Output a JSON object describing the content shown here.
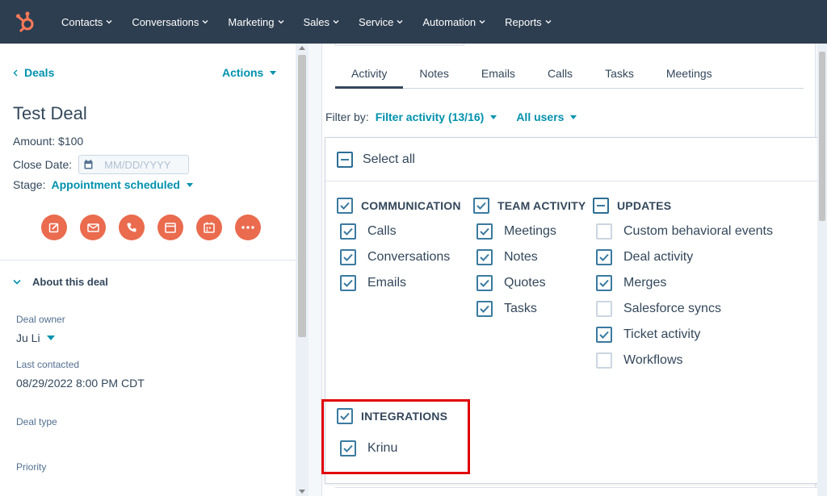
{
  "nav": {
    "logo": "hubspot-logo",
    "items": [
      {
        "label": "Contacts"
      },
      {
        "label": "Conversations"
      },
      {
        "label": "Marketing"
      },
      {
        "label": "Sales"
      },
      {
        "label": "Service"
      },
      {
        "label": "Automation"
      },
      {
        "label": "Reports"
      }
    ]
  },
  "left": {
    "back_label": "Deals",
    "actions_label": "Actions",
    "title": "Test Deal",
    "amount": "Amount: $100",
    "close_date_label": "Close Date:",
    "close_date_placeholder": "MM/DD/YYYY",
    "stage_label": "Stage:",
    "stage_value": "Appointment scheduled",
    "action_icons": [
      "note-icon",
      "email-icon",
      "call-icon",
      "task-icon",
      "meeting-icon",
      "more-icon"
    ],
    "about_label": "About this deal",
    "fields": [
      {
        "label": "Deal owner",
        "value": "Ju Li"
      },
      {
        "label": "Last contacted",
        "value": "08/29/2022 8:00 PM CDT"
      },
      {
        "label": "Deal type",
        "value": ""
      },
      {
        "label": "Priority",
        "value": ""
      }
    ]
  },
  "right": {
    "tabs": [
      {
        "label": "Activity",
        "active": true
      },
      {
        "label": "Notes"
      },
      {
        "label": "Emails"
      },
      {
        "label": "Calls"
      },
      {
        "label": "Tasks"
      },
      {
        "label": "Meetings"
      }
    ],
    "filter_by_label": "Filter by:",
    "filter_activity": "Filter activity (13/16)",
    "all_users": "All users",
    "dropdown": {
      "select_all": "Select all",
      "groups": {
        "communication": {
          "label": "COMMUNICATION",
          "items": [
            "Calls",
            "Conversations",
            "Emails"
          ]
        },
        "team_activity": {
          "label": "TEAM ACTIVITY",
          "items": [
            "Meetings",
            "Notes",
            "Quotes",
            "Tasks"
          ]
        },
        "updates": {
          "label": "UPDATES",
          "items": [
            "Custom behavioral events",
            "Deal activity",
            "Merges",
            "Salesforce syncs",
            "Ticket activity",
            "Workflows"
          ]
        },
        "integrations": {
          "label": "INTEGRATIONS",
          "items": [
            "Krinu"
          ]
        }
      }
    }
  },
  "colors": {
    "nav_bg": "#2d3e50",
    "accent": "#0091ae",
    "action_icon_bg": "#ea6b4e",
    "checkbox": "#3a7aa0",
    "highlight": "#e00000"
  }
}
